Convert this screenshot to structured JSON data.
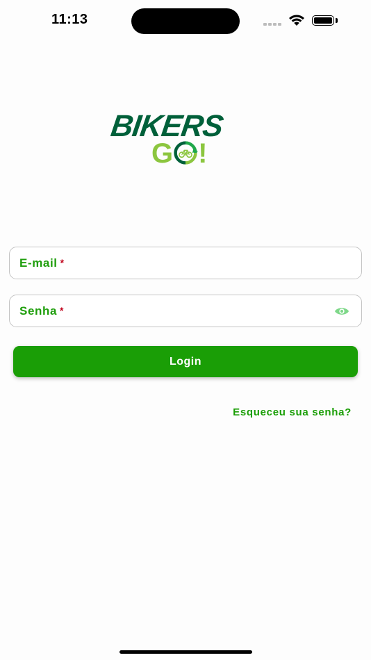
{
  "status": {
    "time": "11:13"
  },
  "logo": {
    "line1": "BIKERS",
    "line2_left": "G",
    "line2_right": "!"
  },
  "form": {
    "email_label": "E-mail",
    "password_label": "Senha",
    "required_mark": "*",
    "login_label": "Login",
    "forgot_label": "Esqueceu sua senha?"
  },
  "colors": {
    "brand_dark": "#00603a",
    "brand_light": "#8cc63f",
    "primary": "#1a9e06",
    "required": "#c0001a"
  },
  "icons": [
    "wifi-icon",
    "battery-icon",
    "eye-icon",
    "bike-recycle-icon"
  ]
}
